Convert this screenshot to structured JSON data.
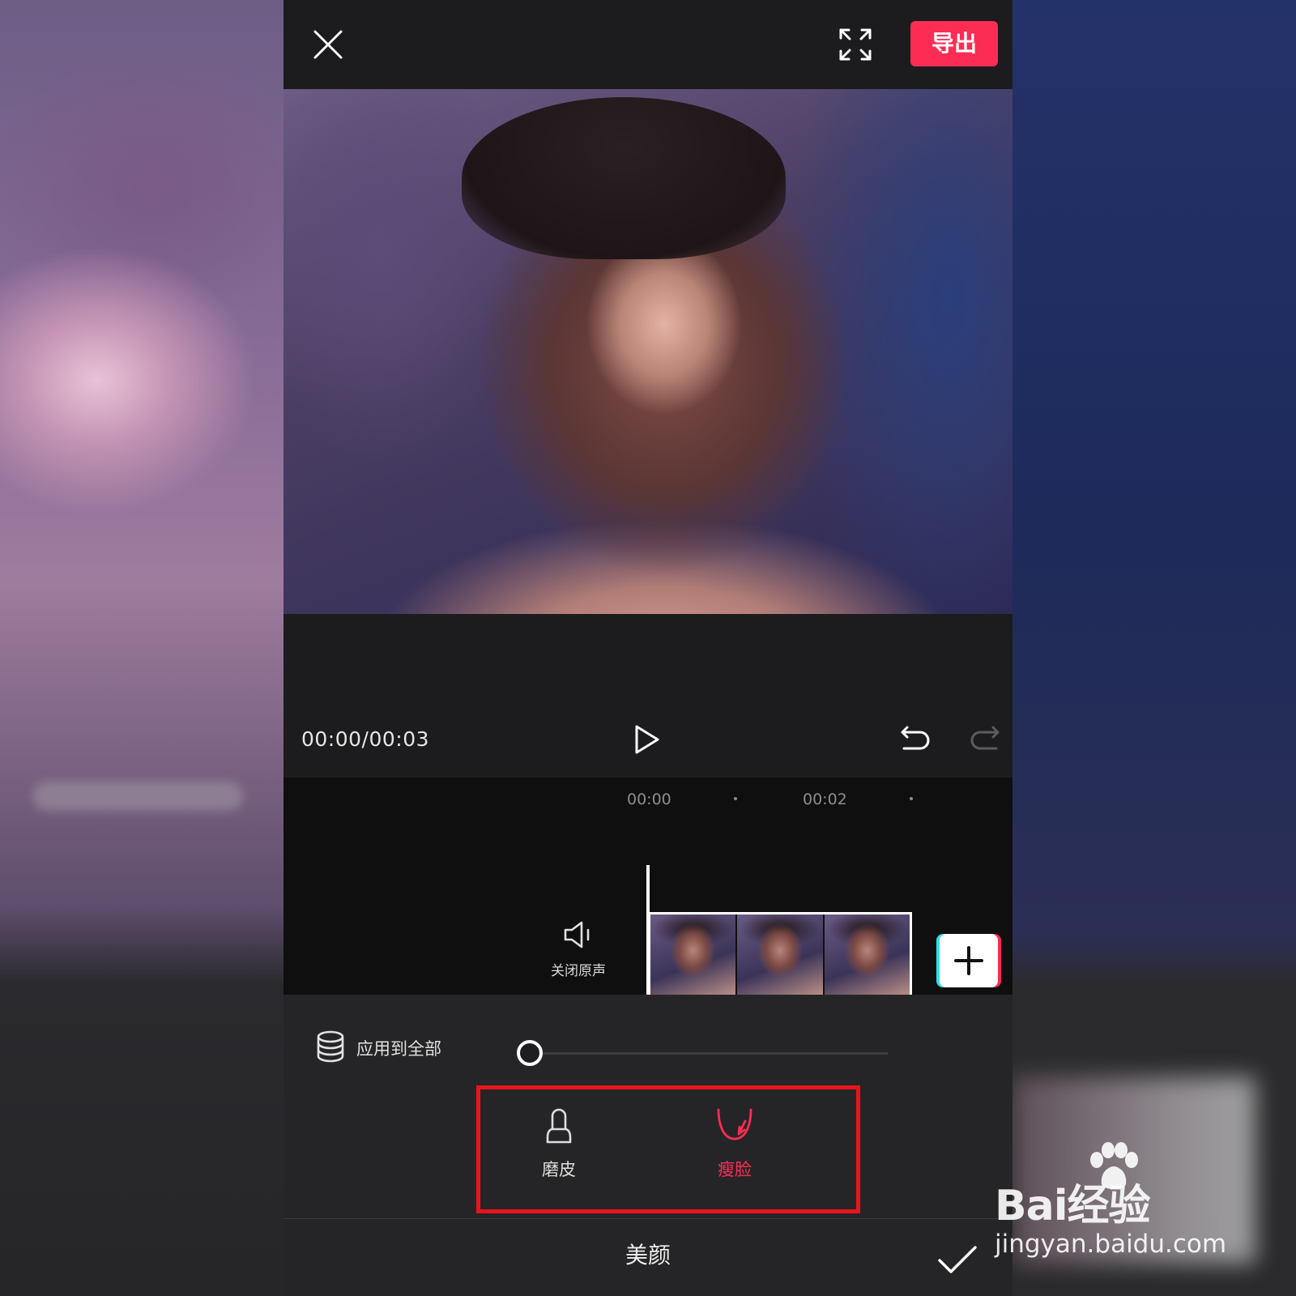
{
  "watermark": {
    "brand_logo_text": "Bai经验",
    "url": "jingyan.baidu.com"
  },
  "topbar": {
    "export_label": "导出"
  },
  "player": {
    "time": "00:00/00:03"
  },
  "timeline": {
    "ticks": [
      "00:00",
      "00:02"
    ],
    "mute_label": "关闭原声"
  },
  "panel": {
    "apply_all_label": "应用到全部",
    "slider_value": 0,
    "tools": [
      {
        "label": "磨皮",
        "icon": "bell-icon",
        "selected": false
      },
      {
        "label": "瘦脸",
        "icon": "face-slim-icon",
        "selected": true
      }
    ],
    "title": "美颜"
  },
  "colors": {
    "accent": "#fd2c55",
    "highlight": "#e8141c",
    "background": "#1c1c1e"
  }
}
